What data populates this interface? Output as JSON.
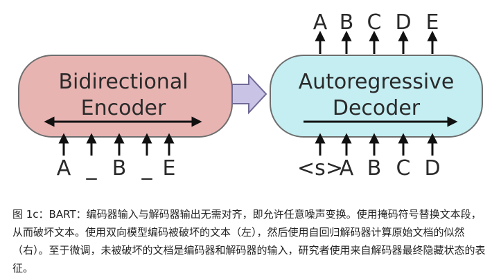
{
  "encoder": {
    "label_line1": "Bidirectional",
    "label_line2": "Encoder",
    "inputs": [
      "A",
      "_",
      "B",
      "_",
      "E"
    ],
    "fill": "#e8b4b2",
    "stroke": "#6e6e6e"
  },
  "decoder": {
    "label_line1": "Autoregressive",
    "label_line2": "Decoder",
    "inputs": [
      "<s>",
      "A",
      "B",
      "C",
      "D"
    ],
    "outputs": [
      "A",
      "B",
      "C",
      "D",
      "E"
    ],
    "fill": "#c4eef2",
    "stroke": "#6e6e6e"
  },
  "connector": {
    "fill": "#c9c3e6",
    "stroke": "#6f6a96"
  },
  "caption": "图 1c：BART：编码器输入与解码器输出无需对齐，即允许任意噪声变换。使用掩码符号替换文本段，从而破坏文本。使用双向模型编码被破坏的文本（左），然后使用自回归解码器计算原始文档的似然（右）。至于微调，未被破坏的文档是编码器和解码器的输入，研究者使用来自解码器最终隐藏状态的表征。"
}
